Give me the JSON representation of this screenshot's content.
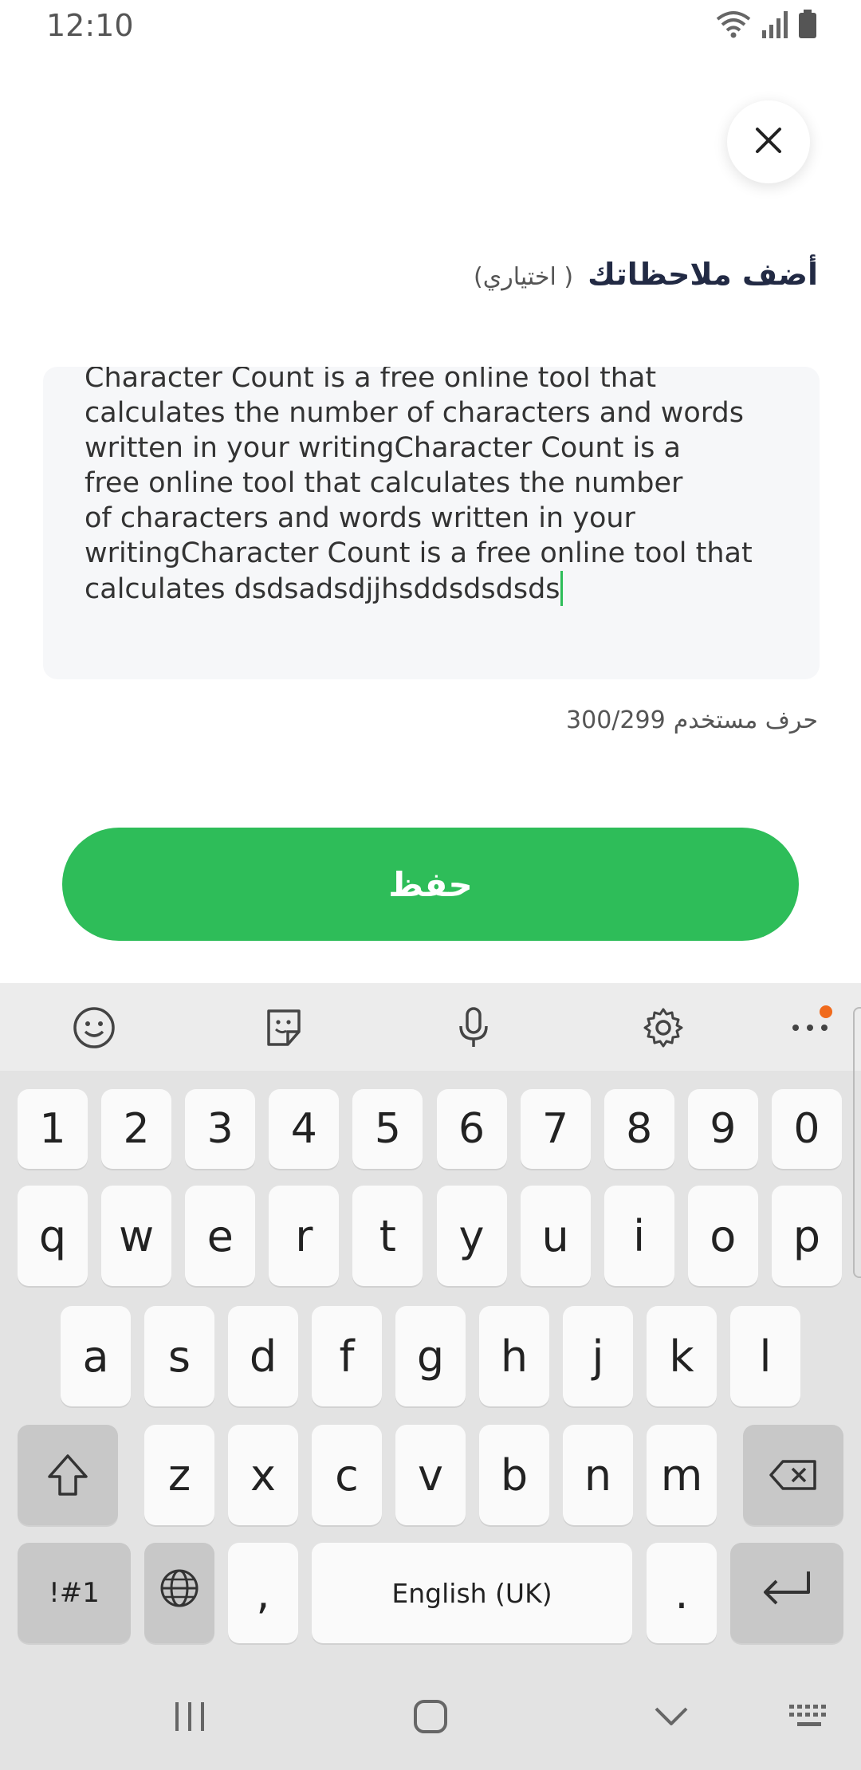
{
  "status_bar": {
    "time": "12:10"
  },
  "form": {
    "title": "أضف ملاحظاتك",
    "optional_label": "( اختياري)",
    "note_text": "Character Count is a free online tool that\ncalculates the number of characters and words\nwritten in your writingCharacter Count is a\nfree online tool that calculates the number\nof characters and words written in your\nwritingCharacter Count is a free online tool that\ncalculates dsdsadsdjjhsddsdsdsds",
    "counter_value": "300/299",
    "counter_label": "حرف مستخدم",
    "save_label": "حفظ"
  },
  "keyboard": {
    "toolbar_icons": [
      "emoji-icon",
      "sticker-icon",
      "microphone-icon",
      "settings-icon",
      "more-icon"
    ],
    "row_numbers": [
      "1",
      "2",
      "3",
      "4",
      "5",
      "6",
      "7",
      "8",
      "9",
      "0"
    ],
    "row_1": [
      "q",
      "w",
      "e",
      "r",
      "t",
      "y",
      "u",
      "i",
      "o",
      "p"
    ],
    "row_2": [
      "a",
      "s",
      "d",
      "f",
      "g",
      "h",
      "j",
      "k",
      "l"
    ],
    "row_3": [
      "z",
      "x",
      "c",
      "v",
      "b",
      "n",
      "m"
    ],
    "symbols_label": "!#1",
    "comma_label": ",",
    "space_label": "English (UK)",
    "period_label": "."
  },
  "colors": {
    "accent": "#2ebd59",
    "title": "#222a44",
    "notification": "#f06a1c"
  }
}
